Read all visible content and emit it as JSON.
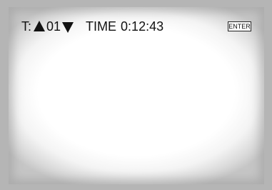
{
  "osd": {
    "title_prefix": "T:",
    "title_number": "01",
    "time_label": "TIME",
    "time_value": "0:12:43"
  },
  "buttons": {
    "enter": "ENTER"
  },
  "icons": {
    "up": "triangle-up-icon",
    "down": "triangle-down-icon"
  },
  "colors": {
    "bezel": "#b5b5b5",
    "screen": "#ffffff",
    "text": "#111111"
  }
}
